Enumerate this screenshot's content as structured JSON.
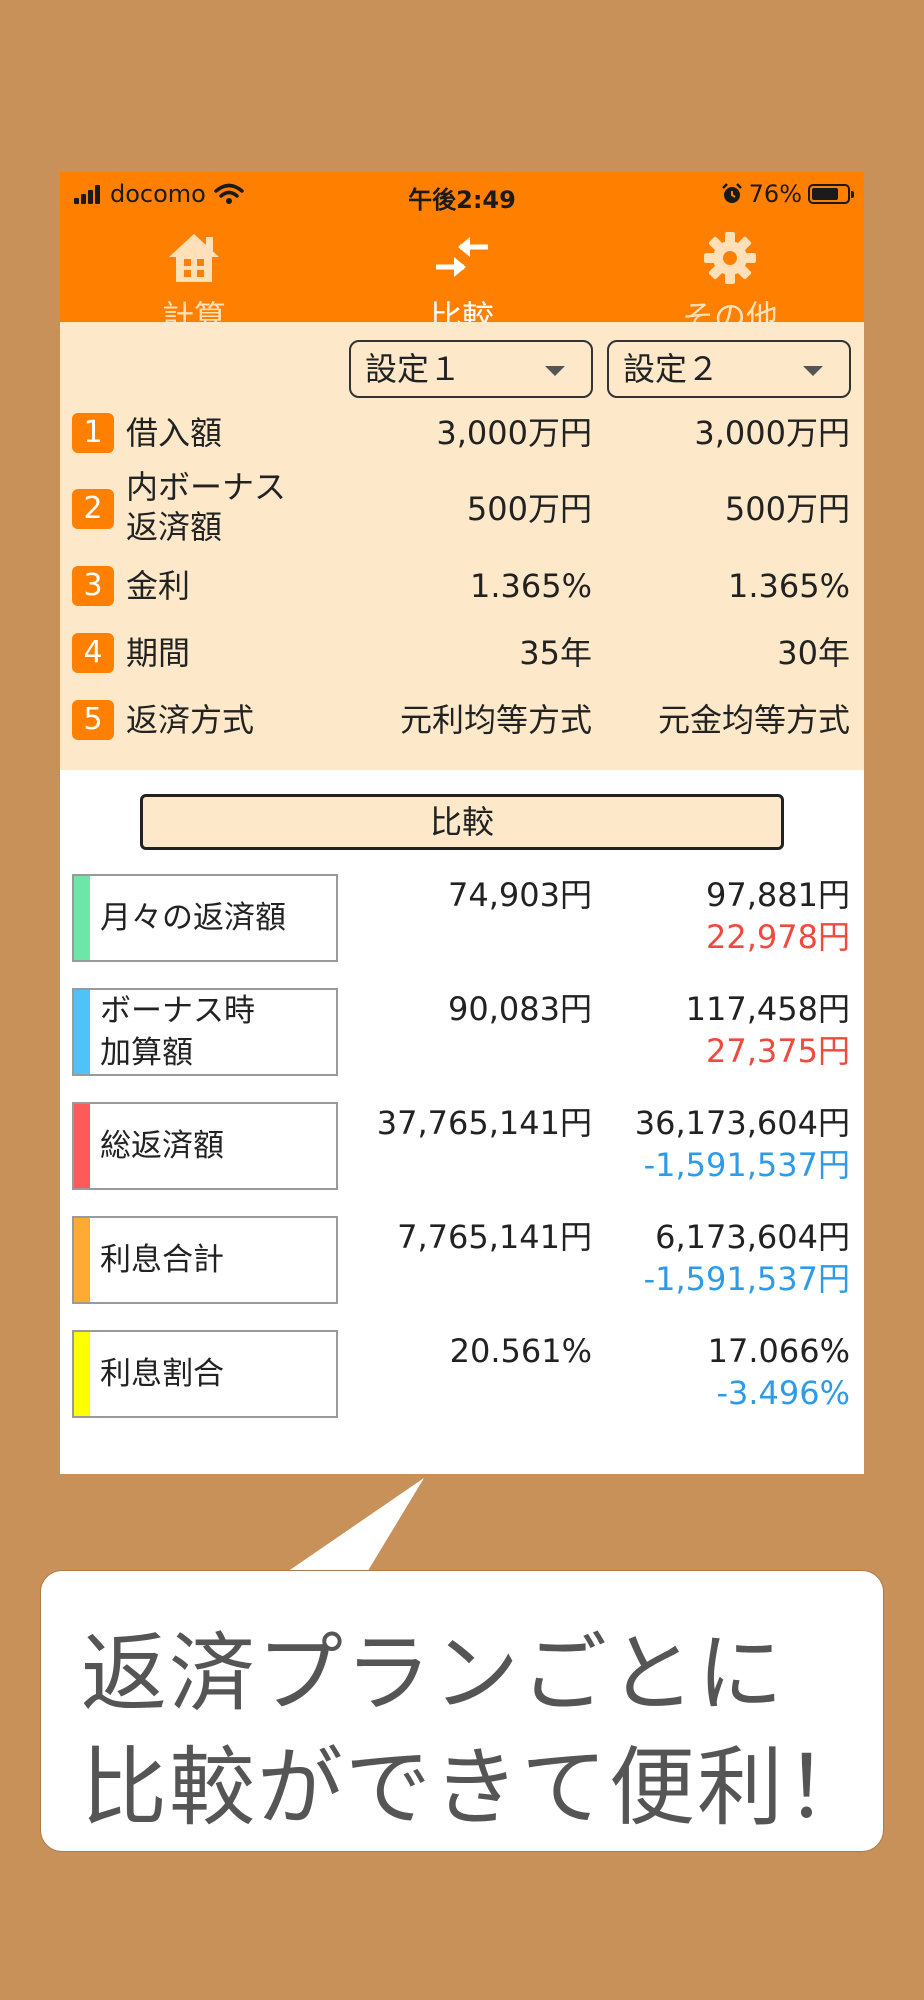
{
  "status_bar": {
    "carrier": "docomo",
    "time": "午後2:49",
    "battery": "76%",
    "battery_level": 0.76
  },
  "tabs": [
    {
      "label": "計算",
      "icon": "home-calculator-icon",
      "active": false
    },
    {
      "label": "比較",
      "icon": "compare-arrows-icon",
      "active": true
    },
    {
      "label": "その他",
      "icon": "gear-icon",
      "active": false
    }
  ],
  "settings": {
    "select1": "設定１",
    "select2": "設定２",
    "rows": [
      {
        "num": "1",
        "label": "借入額",
        "v1": "3,000万円",
        "v2": "3,000万円"
      },
      {
        "num": "2",
        "label": "内ボーナス\n返済額",
        "v1": "500万円",
        "v2": "500万円"
      },
      {
        "num": "3",
        "label": "金利",
        "v1": "1.365%",
        "v2": "1.365%"
      },
      {
        "num": "4",
        "label": "期間",
        "v1": "35年",
        "v2": "30年"
      },
      {
        "num": "5",
        "label": "返済方式",
        "v1": "元利均等方式",
        "v2": "元金均等方式"
      }
    ]
  },
  "compare_button": "比較",
  "results": [
    {
      "label": "月々の返済額",
      "color": "#6EE6A8",
      "v1": "74,903円",
      "v2": "97,881円",
      "diff": "22,978円",
      "diff_color": "red"
    },
    {
      "label": "ボーナス時\n加算額",
      "color": "#4FC3F7",
      "v1": "90,083円",
      "v2": "117,458円",
      "diff": "27,375円",
      "diff_color": "red"
    },
    {
      "label": "総返済額",
      "color": "#FF5A5A",
      "v1": "37,765,141円",
      "v2": "36,173,604円",
      "diff": "-1,591,537円",
      "diff_color": "blue"
    },
    {
      "label": "利息合計",
      "color": "#FFAA33",
      "v1": "7,765,141円",
      "v2": "6,173,604円",
      "diff": "-1,591,537円",
      "diff_color": "blue"
    },
    {
      "label": "利息割合",
      "color": "#FFFF00",
      "v1": "20.561%",
      "v2": "17.066%",
      "diff": "-3.496%",
      "diff_color": "blue"
    }
  ],
  "caption": {
    "line1": "返済プランごとに",
    "line2": "比較ができて便利！"
  }
}
